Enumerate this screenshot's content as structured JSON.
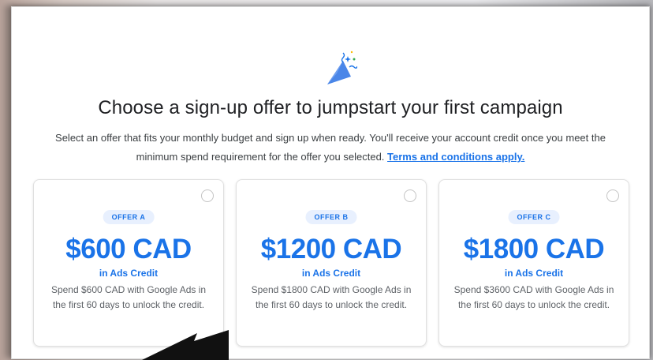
{
  "dialog": {
    "title": "Choose a sign-up offer to jumpstart your first campaign",
    "description": "Select an offer that fits your monthly budget and sign up when ready. You'll receive your account credit once you meet the minimum spend requirement for the offer you selected.",
    "terms_link": "Terms and conditions apply.",
    "icon": "party-popper-icon"
  },
  "offers": [
    {
      "badge": "OFFER A",
      "amount": "$600 CAD",
      "credit_label": "in Ads Credit",
      "description": "Spend $600 CAD with Google Ads in the first 60 days to unlock the credit.",
      "selected": false
    },
    {
      "badge": "OFFER B",
      "amount": "$1200 CAD",
      "credit_label": "in Ads Credit",
      "description": "Spend $1800 CAD with Google Ads in the first 60 days to unlock the credit.",
      "selected": false
    },
    {
      "badge": "OFFER C",
      "amount": "$1800 CAD",
      "credit_label": "in Ads Credit",
      "description": "Spend $3600 CAD with Google Ads in the first 60 days to unlock the credit.",
      "selected": false
    }
  ],
  "colors": {
    "accent": "#1a73e8",
    "badge_bg": "#e8f0fe",
    "text_primary": "#202124",
    "text_secondary": "#5f6368"
  }
}
